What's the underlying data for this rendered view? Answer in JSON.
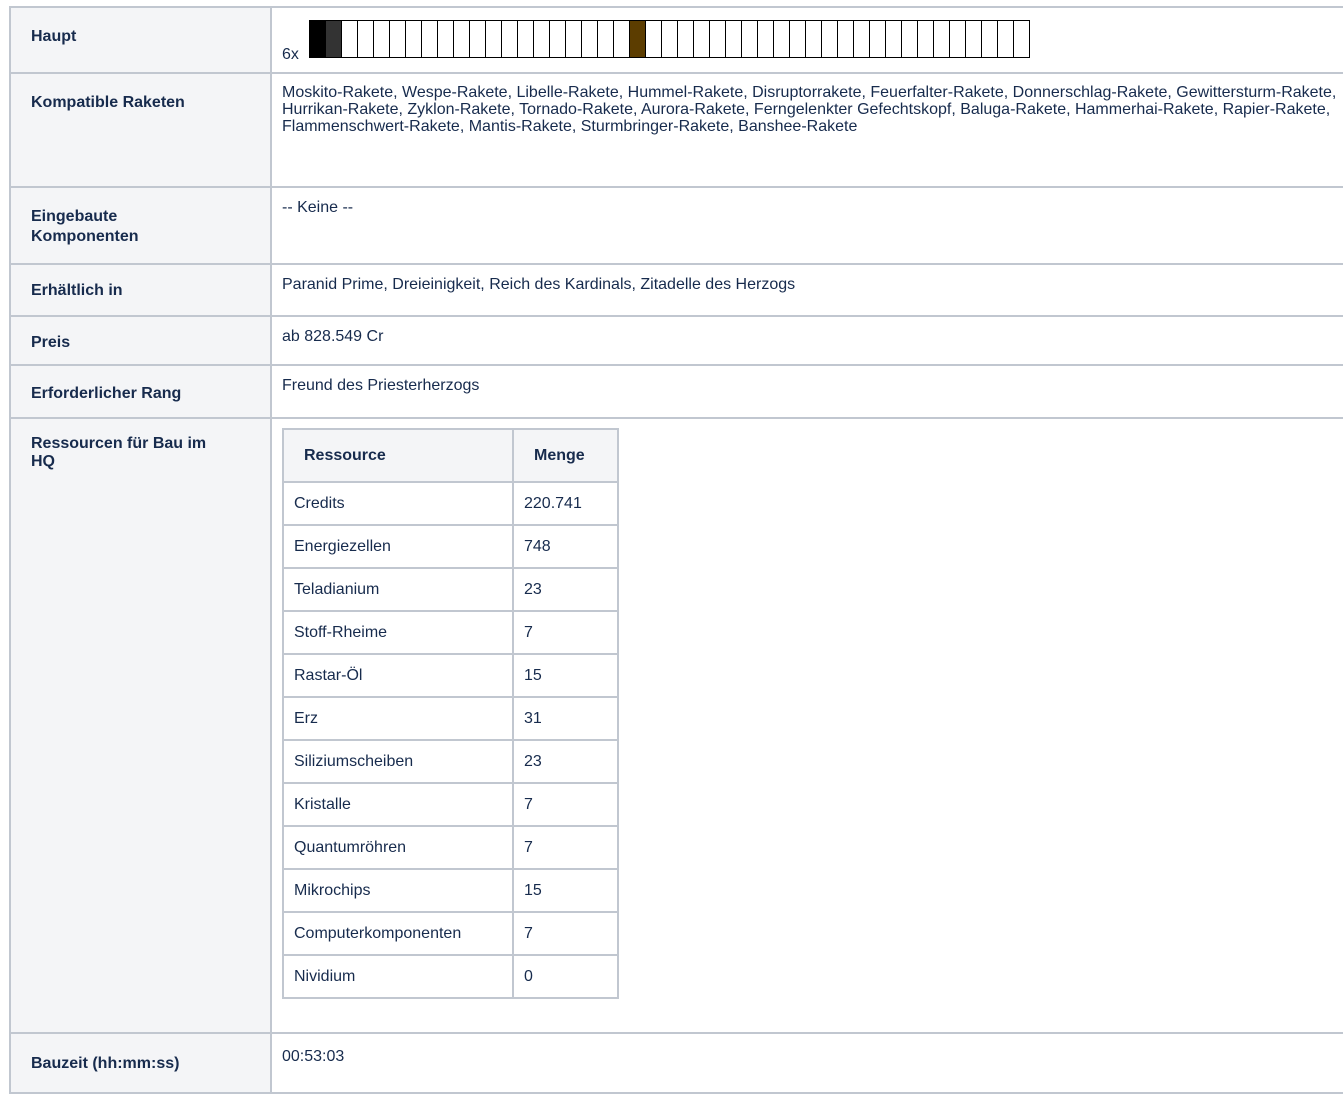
{
  "rows": {
    "haupt": {
      "label": "Haupt",
      "slot_count": "6x",
      "slot_colors": [
        "#000000",
        "#333333",
        "#ffffff",
        "#ffffff",
        "#ffffff",
        "#ffffff",
        "#ffffff",
        "#ffffff",
        "#ffffff",
        "#ffffff",
        "#ffffff",
        "#ffffff",
        "#ffffff",
        "#ffffff",
        "#ffffff",
        "#ffffff",
        "#ffffff",
        "#ffffff",
        "#ffffff",
        "#ffffff",
        "#5c3d00",
        "#ffffff",
        "#ffffff",
        "#ffffff",
        "#ffffff",
        "#ffffff",
        "#ffffff",
        "#ffffff",
        "#ffffff",
        "#ffffff",
        "#ffffff",
        "#ffffff",
        "#ffffff",
        "#ffffff",
        "#ffffff",
        "#ffffff",
        "#ffffff",
        "#ffffff",
        "#ffffff",
        "#ffffff",
        "#ffffff",
        "#ffffff",
        "#ffffff",
        "#ffffff",
        "#ffffff"
      ]
    },
    "kompatibel": {
      "label": "Kompatible Raketen",
      "value": "Moskito-Rakete, Wespe-Rakete, Libelle-Rakete, Hummel-Rakete, Disruptorrakete, Feuerfalter-Rakete, Donnerschlag-Rakete, Gewittersturm-Rakete, Hurrikan-Rakete, Zyklon-Rakete, Tornado-Rakete, Aurora-Rakete, Ferngelenkter Gefechtskopf, Baluga-Rakete, Hammerhai-Rakete, Rapier-Rakete, Flammenschwert-Rakete, Mantis-Rakete, Sturmbringer-Rakete, Banshee-Rakete"
    },
    "eingebaut": {
      "label": "Eingebaute Komponenten",
      "value": "-- Keine --"
    },
    "erhaeltlich": {
      "label": "Erhältlich in",
      "value": "Paranid Prime, Dreieinigkeit, Reich des Kardinals, Zitadelle des Herzogs"
    },
    "preis": {
      "label": "Preis",
      "value": "ab 828.549 Cr"
    },
    "rang": {
      "label": "Erforderlicher Rang",
      "value": "Freund des Priesterherzogs"
    },
    "ressourcen": {
      "label": "Ressourcen für Bau im HQ",
      "col_resource": "Ressource",
      "col_amount": "Menge",
      "items": [
        {
          "name": "Credits",
          "amount": "220.741"
        },
        {
          "name": "Energiezellen",
          "amount": "748"
        },
        {
          "name": "Teladianium",
          "amount": "23"
        },
        {
          "name": "Stoff-Rheime",
          "amount": "7"
        },
        {
          "name": "Rastar-Öl",
          "amount": "15"
        },
        {
          "name": "Erz",
          "amount": "31"
        },
        {
          "name": "Siliziumscheiben",
          "amount": "23"
        },
        {
          "name": "Kristalle",
          "amount": "7"
        },
        {
          "name": "Quantumröhren",
          "amount": "7"
        },
        {
          "name": "Mikrochips",
          "amount": "15"
        },
        {
          "name": "Computerkomponenten",
          "amount": "7"
        },
        {
          "name": "Nividium",
          "amount": "0"
        }
      ]
    },
    "bauzeit": {
      "label": "Bauzeit (hh:mm:ss)",
      "value": "00:53:03"
    }
  }
}
